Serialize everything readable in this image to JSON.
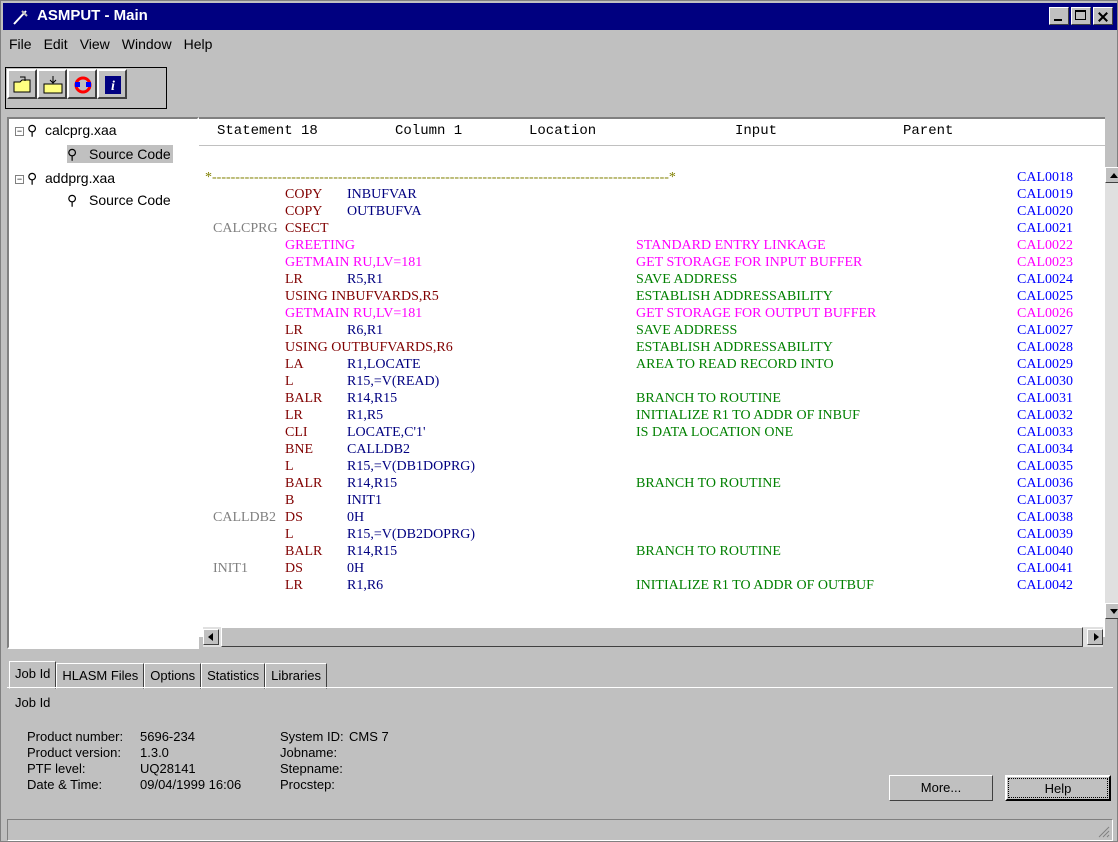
{
  "window": {
    "title": "ASMPUT - Main"
  },
  "menu": [
    "File",
    "Edit",
    "View",
    "Window",
    "Help"
  ],
  "toolbar": [
    "open-folder-icon",
    "load-icon",
    "refresh-icon",
    "info-icon"
  ],
  "tree": [
    {
      "label": "calcprg.xaa",
      "expanded": true,
      "children": [
        {
          "label": "Source Code",
          "selected": true
        }
      ]
    },
    {
      "label": "addprg.xaa",
      "expanded": true,
      "children": [
        {
          "label": "Source Code",
          "selected": false
        }
      ]
    }
  ],
  "code_header": {
    "statement": "Statement 18",
    "column": "Column 1",
    "location": "Location",
    "input": "Input",
    "parent": "Parent"
  },
  "code_lines": [
    {
      "label": "",
      "op": "",
      "operand": "",
      "comment": "",
      "seq": "CAL0018",
      "color": "#808000",
      "star": true
    },
    {
      "label": "",
      "op": "COPY",
      "operand": "INBUFVAR",
      "comment": "",
      "seq": "CAL0019",
      "color": "#800000"
    },
    {
      "label": "",
      "op": "COPY",
      "operand": "OUTBUFVA",
      "comment": "",
      "seq": "CAL0020",
      "color": "#800000"
    },
    {
      "label": "CALCPRG",
      "op": "CSECT",
      "operand": "",
      "comment": "",
      "seq": "CAL0021",
      "color": "#800000"
    },
    {
      "label": "",
      "op": "GREETING",
      "operand": "",
      "comment": "STANDARD ENTRY LINKAGE",
      "seq": "CAL0022",
      "color": "#ff00ff"
    },
    {
      "label": "",
      "op": "GETMAIN RU,LV=181",
      "operand": "",
      "comment": "GET STORAGE FOR INPUT BUFFER",
      "seq": "CAL0023",
      "color": "#ff00ff"
    },
    {
      "label": "",
      "op": "LR",
      "operand": "R5,R1",
      "comment": "SAVE ADDRESS",
      "seq": "CAL0024",
      "color": "#800000"
    },
    {
      "label": "",
      "op": "USING INBUFVARDS,R5",
      "operand": "",
      "comment": "ESTABLISH ADDRESSABILITY",
      "seq": "CAL0025",
      "color": "#800000"
    },
    {
      "label": "",
      "op": "GETMAIN RU,LV=181",
      "operand": "",
      "comment": "GET STORAGE FOR OUTPUT BUFFER",
      "seq": "CAL0026",
      "color": "#ff00ff"
    },
    {
      "label": "",
      "op": "LR",
      "operand": "R6,R1",
      "comment": "SAVE ADDRESS",
      "seq": "CAL0027",
      "color": "#800000"
    },
    {
      "label": "",
      "op": "USING OUTBUFVARDS,R6",
      "operand": "",
      "comment": "ESTABLISH ADDRESSABILITY",
      "seq": "CAL0028",
      "color": "#800000"
    },
    {
      "label": "",
      "op": "LA",
      "operand": "R1,LOCATE",
      "comment": "AREA TO READ RECORD INTO",
      "seq": "CAL0029",
      "color": "#800000"
    },
    {
      "label": "",
      "op": "L",
      "operand": "R15,=V(READ)",
      "comment": "",
      "seq": "CAL0030",
      "color": "#800000"
    },
    {
      "label": "",
      "op": "BALR",
      "operand": "R14,R15",
      "comment": "BRANCH TO ROUTINE",
      "seq": "CAL0031",
      "color": "#800000"
    },
    {
      "label": "",
      "op": "LR",
      "operand": "R1,R5",
      "comment": "INITIALIZE R1 TO ADDR OF INBUF",
      "seq": "CAL0032",
      "color": "#800000"
    },
    {
      "label": "",
      "op": "CLI",
      "operand": "LOCATE,C'1'",
      "comment": "IS DATA LOCATION ONE",
      "seq": "CAL0033",
      "color": "#800000"
    },
    {
      "label": "",
      "op": "BNE",
      "operand": "CALLDB2",
      "comment": "",
      "seq": "CAL0034",
      "color": "#800000"
    },
    {
      "label": "",
      "op": "L",
      "operand": "R15,=V(DB1DOPRG)",
      "comment": "",
      "seq": "CAL0035",
      "color": "#800000"
    },
    {
      "label": "",
      "op": "BALR",
      "operand": "R14,R15",
      "comment": "BRANCH TO ROUTINE",
      "seq": "CAL0036",
      "color": "#800000"
    },
    {
      "label": "",
      "op": "B",
      "operand": "INIT1",
      "comment": "",
      "seq": "CAL0037",
      "color": "#800000"
    },
    {
      "label": "CALLDB2",
      "op": "DS",
      "operand": "0H",
      "comment": "",
      "seq": "CAL0038",
      "color": "#800000"
    },
    {
      "label": "",
      "op": "L",
      "operand": "R15,=V(DB2DOPRG)",
      "comment": "",
      "seq": "CAL0039",
      "color": "#800000"
    },
    {
      "label": "",
      "op": "BALR",
      "operand": "R14,R15",
      "comment": "BRANCH TO ROUTINE",
      "seq": "CAL0040",
      "color": "#800000"
    },
    {
      "label": "INIT1",
      "op": "DS",
      "operand": "0H",
      "comment": "",
      "seq": "CAL0041",
      "color": "#800000"
    },
    {
      "label": "",
      "op": "LR",
      "operand": "R1,R6",
      "comment": "INITIALIZE R1 TO ADDR OF OUTBUF",
      "seq": "CAL0042",
      "color": "#800000"
    }
  ],
  "colors": {
    "operand": "#000080",
    "comment": "#008000",
    "sequence": "#0000ff",
    "title": "#000080"
  },
  "tabs": [
    {
      "label": "Job Id",
      "active": true
    },
    {
      "label": "HLASM Files"
    },
    {
      "label": "Options"
    },
    {
      "label": "Statistics"
    },
    {
      "label": "Libraries"
    }
  ],
  "jobid": {
    "title": "Job Id",
    "product_number_label": "Product number:",
    "product_number": "5696-234",
    "product_version_label": "Product version:",
    "product_version": "1.3.0",
    "ptf_label": "PTF level:",
    "ptf": "UQ28141",
    "date_label": "Date & Time:",
    "date": "09/04/1999 16:06",
    "system_id_label": "System ID:",
    "system_id": "CMS 7",
    "jobname_label": "Jobname:",
    "stepname_label": "Stepname:",
    "procstep_label": "Procstep:"
  },
  "buttons": {
    "more": "More...",
    "help": "Help"
  }
}
